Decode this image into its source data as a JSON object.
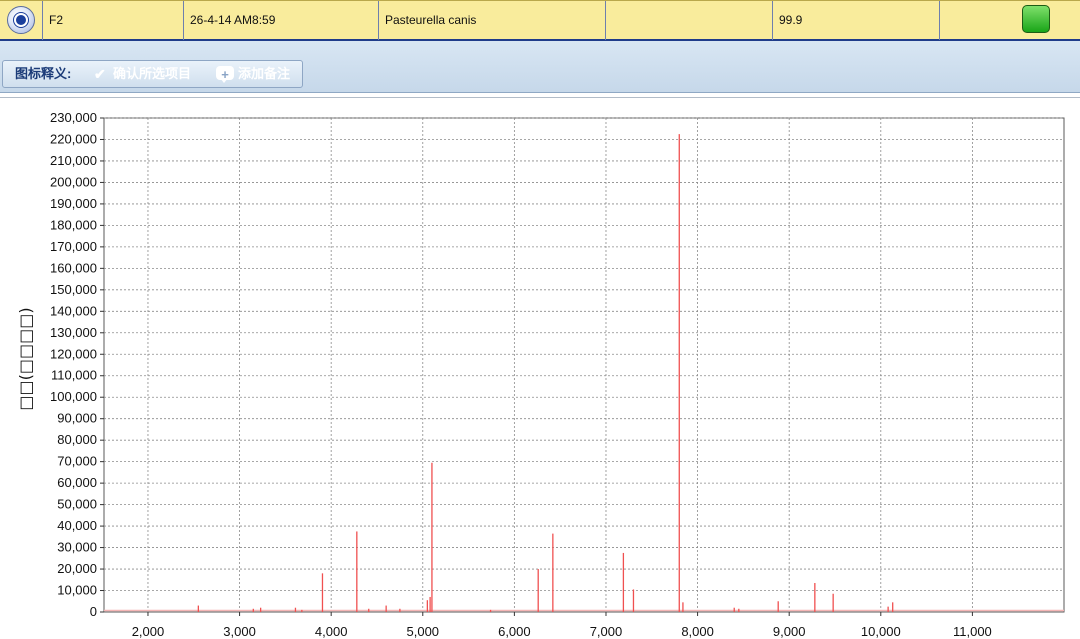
{
  "result_row": {
    "sample": "F2",
    "timestamp": "26-4-14 AM8:59",
    "organism": "Pasteurella canis",
    "empty_col": "",
    "score": "99.9",
    "empty_col2": "",
    "status_color": "#2fb52a"
  },
  "legend": {
    "title": "图标释义:",
    "confirm_label": "确认所选项目",
    "add_note_label": "添加备注",
    "check_icon": "check-icon",
    "note_icon": "comment-icon"
  },
  "colors": {
    "peak": "#f05050",
    "grid": "#8a8a8a",
    "row_bg": "#f9ec9c",
    "legend_bg": "#d0dfee"
  },
  "chart_data": {
    "type": "bar",
    "ylabel": "□□(□□□□)",
    "xlabel": "",
    "title": "",
    "xlim": [
      1520,
      12000
    ],
    "ylim": [
      0,
      230000
    ],
    "xticks": [
      2000,
      3000,
      4000,
      5000,
      6000,
      7000,
      8000,
      9000,
      10000,
      11000
    ],
    "xtick_labels": [
      "2,000",
      "3,000",
      "4,000",
      "5,000",
      "6,000",
      "7,000",
      "8,000",
      "9,000",
      "10,000",
      "11,000"
    ],
    "yticks": [
      0,
      10000,
      20000,
      30000,
      40000,
      50000,
      60000,
      70000,
      80000,
      90000,
      100000,
      110000,
      120000,
      130000,
      140000,
      150000,
      160000,
      170000,
      180000,
      190000,
      200000,
      210000,
      220000,
      230000
    ],
    "ytick_labels": [
      "0",
      "10,000",
      "20,000",
      "30,000",
      "40,000",
      "50,000",
      "60,000",
      "70,000",
      "80,000",
      "90,000",
      "100,000",
      "110,000",
      "120,000",
      "130,000",
      "140,000",
      "150,000",
      "160,000",
      "170,000",
      "180,000",
      "190,000",
      "200,000",
      "210,000",
      "220,000",
      "230,000"
    ],
    "grid": true,
    "peaks": [
      {
        "x": 2550,
        "y": 3000
      },
      {
        "x": 3150,
        "y": 1500
      },
      {
        "x": 3230,
        "y": 2000
      },
      {
        "x": 3610,
        "y": 2000
      },
      {
        "x": 3680,
        "y": 1000
      },
      {
        "x": 3905,
        "y": 18000
      },
      {
        "x": 4280,
        "y": 37500
      },
      {
        "x": 4410,
        "y": 1500
      },
      {
        "x": 4600,
        "y": 3000
      },
      {
        "x": 4750,
        "y": 1500
      },
      {
        "x": 5050,
        "y": 5500
      },
      {
        "x": 5080,
        "y": 7000
      },
      {
        "x": 5100,
        "y": 69500
      },
      {
        "x": 5740,
        "y": 1000
      },
      {
        "x": 6260,
        "y": 20000
      },
      {
        "x": 6420,
        "y": 36500
      },
      {
        "x": 7190,
        "y": 27500
      },
      {
        "x": 7300,
        "y": 10500
      },
      {
        "x": 7800,
        "y": 222500
      },
      {
        "x": 7840,
        "y": 4500
      },
      {
        "x": 8400,
        "y": 2000
      },
      {
        "x": 8450,
        "y": 1500
      },
      {
        "x": 8880,
        "y": 5000
      },
      {
        "x": 9280,
        "y": 13500
      },
      {
        "x": 9480,
        "y": 8500
      },
      {
        "x": 10080,
        "y": 2500
      },
      {
        "x": 10130,
        "y": 4500
      }
    ]
  }
}
